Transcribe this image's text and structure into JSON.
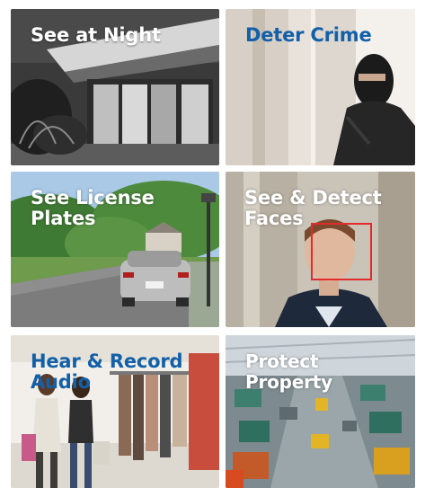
{
  "tiles": [
    {
      "label": "See at Night"
    },
    {
      "label": "Deter Crime"
    },
    {
      "label": "See License Plates"
    },
    {
      "label": "See & Detect Faces"
    },
    {
      "label": "Hear & Record Audio"
    },
    {
      "label": "Protect Property"
    }
  ],
  "colors": {
    "label_white": "#ffffff",
    "label_blue": "#1260a8",
    "face_box": "#e32b2b"
  },
  "icons": [
    "night-house-image",
    "burglar-image",
    "car-street-image",
    "face-detection-image",
    "shopping-store-image",
    "factory-floor-image"
  ]
}
